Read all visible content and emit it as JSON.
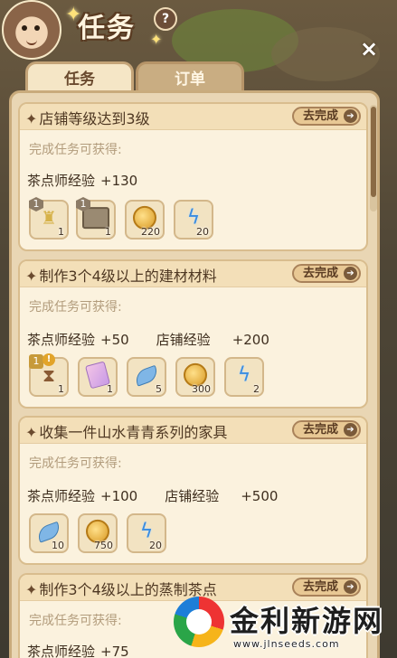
{
  "header": {
    "title": "任务",
    "help_glyph": "?",
    "close_glyph": "×"
  },
  "tabs": [
    {
      "label": "任务",
      "active": true
    },
    {
      "label": "订单",
      "active": false
    }
  ],
  "tasks": [
    {
      "title": "店铺等级达到3级",
      "button": "去完成",
      "reward_label": "完成任务可获得:",
      "exp": [
        {
          "label": "茶点师经验",
          "value": "+130"
        }
      ],
      "items": [
        {
          "icon": "trophy-icon",
          "qty": "1",
          "level": "1"
        },
        {
          "icon": "machine-icon",
          "qty": "1",
          "level": "1"
        },
        {
          "icon": "coin-icon",
          "qty": "220"
        },
        {
          "icon": "bolt-icon",
          "qty": "20"
        }
      ]
    },
    {
      "title": "制作3个4级以上的建材材料",
      "button": "去完成",
      "reward_label": "完成任务可获得:",
      "exp": [
        {
          "label": "茶点师经验",
          "value": "+50"
        },
        {
          "label": "店铺经验",
          "value": "+200"
        }
      ],
      "items": [
        {
          "icon": "hourglass-icon",
          "qty": "1",
          "level": "1",
          "alert": "!"
        },
        {
          "icon": "ticket-icon",
          "qty": "1"
        },
        {
          "icon": "leaf-icon",
          "qty": "5"
        },
        {
          "icon": "coin-icon",
          "qty": "300"
        },
        {
          "icon": "bolt-icon",
          "qty": "2"
        }
      ]
    },
    {
      "title": "收集一件山水青青系列的家具",
      "button": "去完成",
      "reward_label": "完成任务可获得:",
      "exp": [
        {
          "label": "茶点师经验",
          "value": "+100"
        },
        {
          "label": "店铺经验",
          "value": "+500"
        }
      ],
      "items": [
        {
          "icon": "leaf-icon",
          "qty": "10"
        },
        {
          "icon": "coin-icon",
          "qty": "750"
        },
        {
          "icon": "bolt-icon",
          "qty": "20"
        }
      ]
    },
    {
      "title": "制作3个4级以上的蒸制茶点",
      "button": "去完成",
      "reward_label": "完成任务可获得:",
      "exp": [
        {
          "label": "茶点师经验",
          "value": "+75"
        }
      ],
      "items": []
    }
  ],
  "watermark": {
    "name": "金利新游网",
    "url": "www.jlnseeds.com"
  },
  "colors": {
    "panel": "#e9d6b4",
    "card": "#fbf2de",
    "button": "#e8c894",
    "title_text": "#4e3722"
  }
}
